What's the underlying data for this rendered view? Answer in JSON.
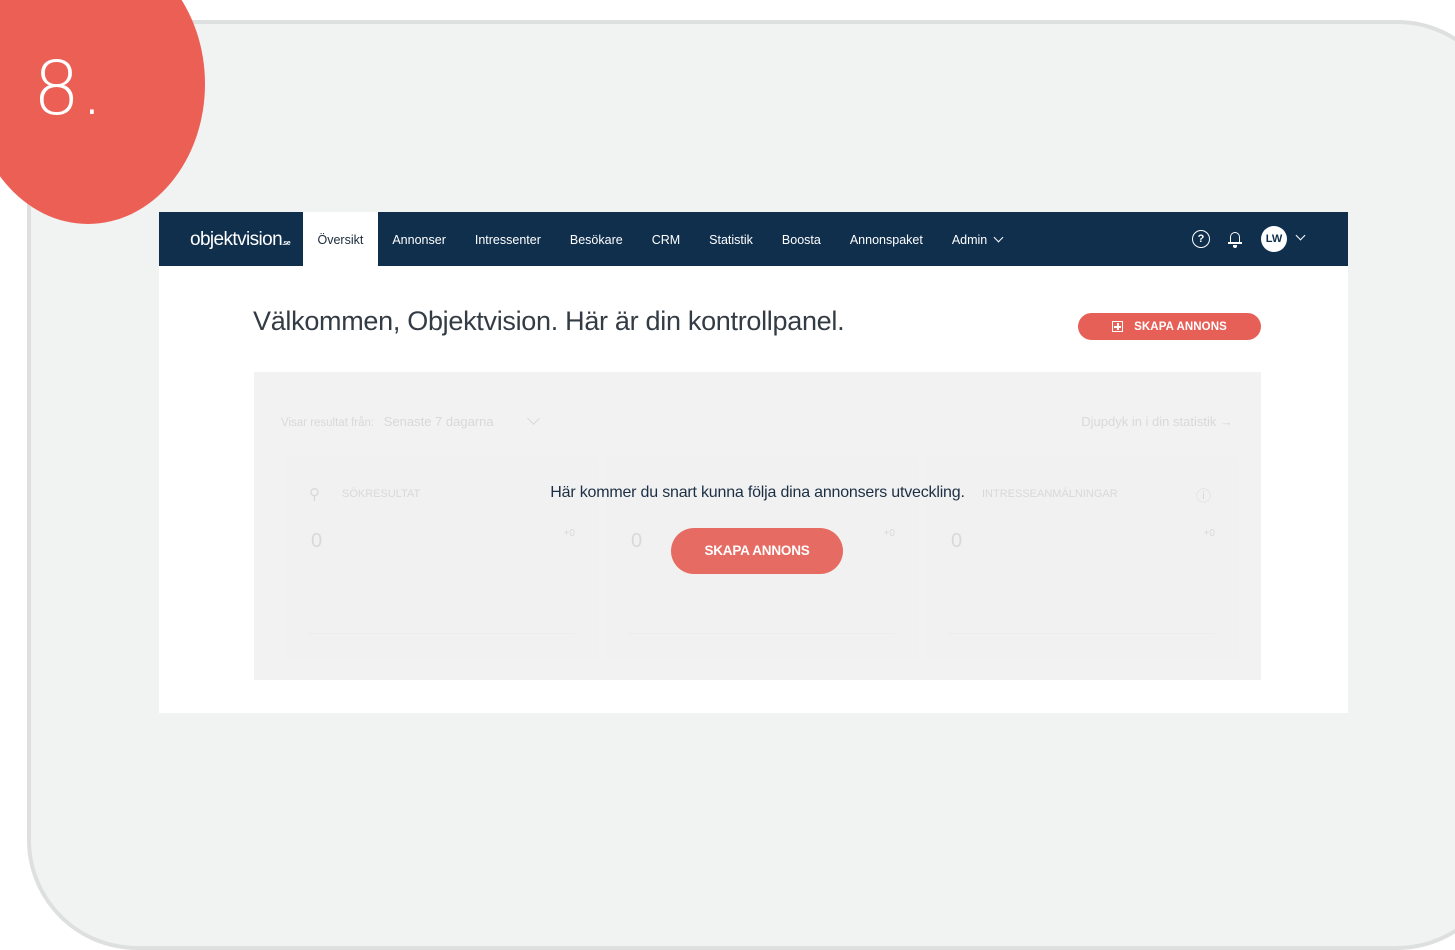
{
  "step": {
    "number": "8."
  },
  "nav": {
    "logo": "objektvision",
    "logo_suffix": ".se",
    "items": [
      {
        "label": "Översikt",
        "active": true
      },
      {
        "label": "Annonser"
      },
      {
        "label": "Intressenter"
      },
      {
        "label": "Besökare"
      },
      {
        "label": "CRM"
      },
      {
        "label": "Statistik"
      },
      {
        "label": "Boosta"
      },
      {
        "label": "Annonspaket"
      },
      {
        "label": "Admin",
        "dropdown": true
      }
    ],
    "help_glyph": "?",
    "avatar_initials": "LW"
  },
  "main": {
    "title": "Välkommen, Objektvision. Här är din kontrollpanel.",
    "create_button": "SKAPA ANNONS"
  },
  "dashboard": {
    "range_label": "Visar resultat från:",
    "range_value": "Senaste 7 dagarna",
    "deep_link": "Djupdyk in i din statistik",
    "deep_link_arrow": "→",
    "cards": [
      {
        "label": "SÖKRESULTAT",
        "value": "0",
        "delta": "+0"
      },
      {
        "label": "",
        "value": "0",
        "delta": "+0"
      },
      {
        "label": "INTRESSEANMÄLNINGAR",
        "value": "0",
        "delta": "+0"
      }
    ],
    "overlay_message": "Här kommer du snart kunna följa dina annonsers utveckling.",
    "overlay_button": "SKAPA ANNONS"
  },
  "colors": {
    "accent": "#e66058",
    "nav_bg": "#0f2f4d",
    "step_badge": "#ec5f55"
  }
}
